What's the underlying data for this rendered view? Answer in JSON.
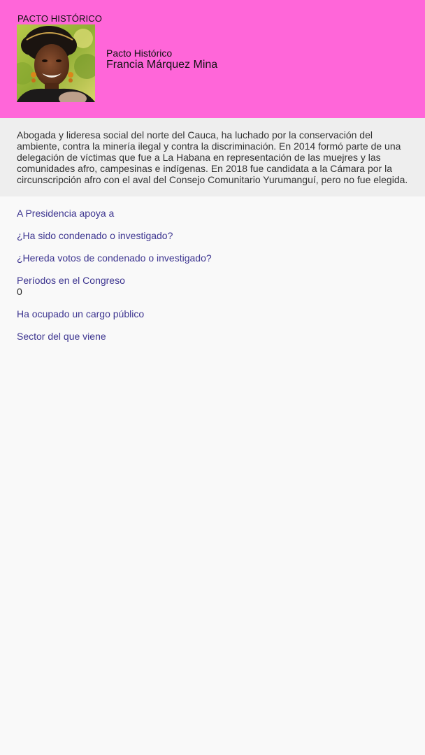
{
  "header": {
    "party_tag": "PACTO HISTÓRICO",
    "party_name": "Pacto Histórico",
    "candidate_name": "Francia Márquez Mina",
    "background_color": "#ff66d9"
  },
  "bio": "Abogada y lideresa social del norte del Cauca, ha luchado por la conservación del ambiente, contra la minería ilegal y contra la discriminación. En 2014 formó parte de una delegación de víctimas que fue a La Habana en representación de las muejres y las comunidades afro, campesinas e indígenas. En 2018 fue candidata a la Cámara por la circunscripción afro con el aval del Consejo Comunitario Yurumanguí, pero no fue elegida.",
  "details": {
    "presidency_label": "A Presidencia apoya a",
    "presidency_value": "",
    "condemned_label": "¿Ha sido condenado o investigado?",
    "condemned_value": "",
    "inherits_label": "¿Hereda votos de condenado o investigado?",
    "inherits_value": "",
    "periods_label": "Períodos en el Congreso",
    "periods_value": "0",
    "public_office_label": "Ha ocupado un cargo público",
    "public_office_value": "",
    "sector_label": "Sector del que viene",
    "sector_value": ""
  }
}
